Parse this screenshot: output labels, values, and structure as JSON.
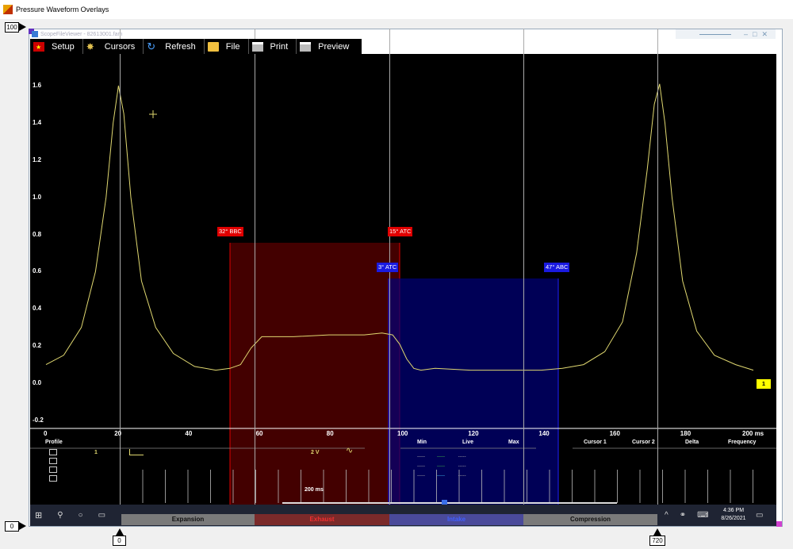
{
  "window": {
    "title": "Pressure Waveform Overlays"
  },
  "inner_window": {
    "title": "ScopeFileViewer - 82613001.fam"
  },
  "markers": {
    "top_left": "100",
    "bottom_left": "0",
    "cursor_left": "0",
    "cursor_right": "720"
  },
  "toolbar": {
    "setup": "Setup",
    "cursors": "Cursors",
    "refresh": "Refresh",
    "file": "File",
    "print": "Print",
    "preview": "Preview"
  },
  "y_axis": [
    "1.6",
    "1.4",
    "1.2",
    "1.0",
    "0.8",
    "0.6",
    "0.4",
    "0.2",
    "0.0",
    "-0.2"
  ],
  "x_axis": [
    "0",
    "20",
    "40",
    "60",
    "80",
    "100",
    "120",
    "140",
    "160",
    "180",
    "200 ms"
  ],
  "valve_tags": {
    "exhaust_open": "32° BBC",
    "exhaust_close": "15° ATC",
    "intake_open": "3° ATC",
    "intake_close": "47° ABC"
  },
  "channel_tag": "1",
  "readout_headers": {
    "profile": "Profile",
    "min": "Min",
    "live": "Live",
    "max": "Max",
    "cursor1": "Cursor 1",
    "cursor2": "Cursor 2",
    "delta": "Delta",
    "frequency": "Frequency"
  },
  "channel_row": {
    "num": "1",
    "scale": "2 V"
  },
  "timebase": "200 ms",
  "strokes": {
    "expansion": "Expansion",
    "exhaust": "Exhaust",
    "intake": "Intake",
    "compression": "Compression"
  },
  "clock": {
    "time": "4:36 PM",
    "date": "8/26/2021"
  },
  "colors": {
    "exhaust": "#c00000",
    "intake": "#1010c0",
    "trace": "#e0d870",
    "tag_red": "#e00000",
    "tag_blue": "#1a1ae0"
  },
  "chart_data": {
    "type": "line",
    "xlabel": "",
    "ylabel": "",
    "x_unit": "ms",
    "xlim": [
      0,
      200
    ],
    "ylim": [
      -0.2,
      1.7
    ],
    "series": [
      {
        "x": [
          0,
          5,
          10,
          14,
          17,
          19,
          20.5,
          22,
          24,
          27,
          31,
          36,
          42,
          48,
          52,
          55,
          58,
          61,
          64,
          70,
          80,
          90,
          95,
          98,
          100,
          102,
          104,
          106,
          110,
          120,
          130,
          140,
          146,
          152,
          158,
          163,
          167,
          170,
          172,
          173.5,
          175,
          177,
          180,
          184,
          189,
          195,
          200
        ],
        "y": [
          0.1,
          0.15,
          0.3,
          0.6,
          1.0,
          1.4,
          1.6,
          1.45,
          1.0,
          0.55,
          0.3,
          0.16,
          0.09,
          0.07,
          0.08,
          0.1,
          0.19,
          0.25,
          0.25,
          0.25,
          0.26,
          0.26,
          0.27,
          0.26,
          0.21,
          0.13,
          0.08,
          0.07,
          0.08,
          0.07,
          0.07,
          0.07,
          0.08,
          0.1,
          0.17,
          0.33,
          0.7,
          1.15,
          1.5,
          1.61,
          1.4,
          1.0,
          0.55,
          0.28,
          0.15,
          0.1,
          0.07
        ]
      }
    ]
  }
}
